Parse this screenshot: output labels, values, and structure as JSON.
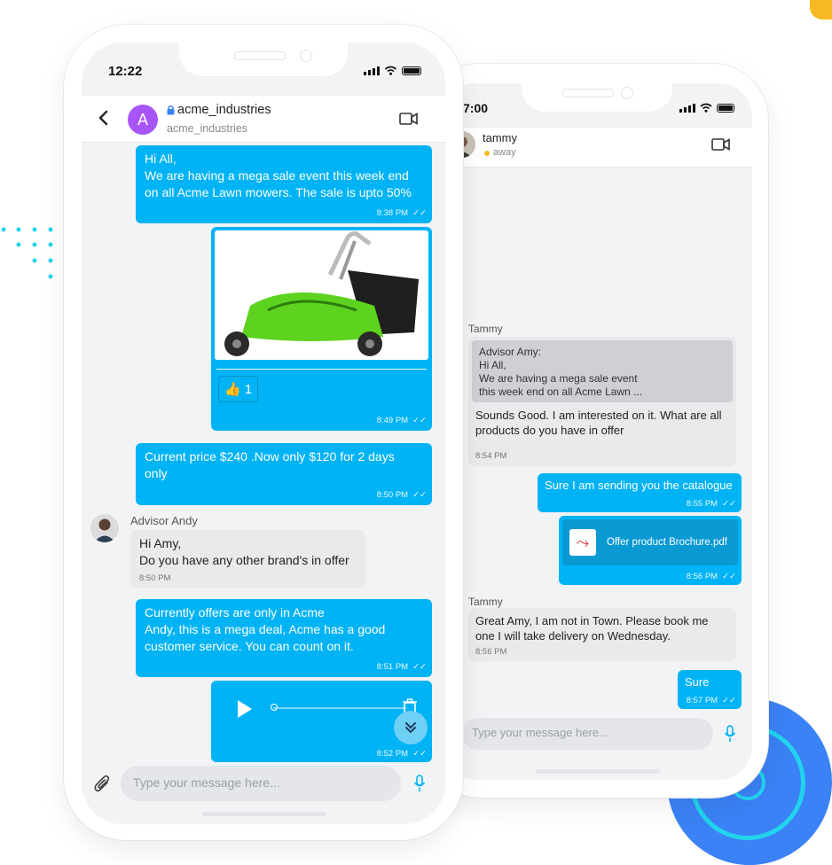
{
  "colors": {
    "accent": "#00b3f5",
    "purple": "#a855f7",
    "yellow": "#f7b924",
    "blue": "#3b82f6",
    "cyan": "#22d3ee",
    "lock": "#3b82f6"
  },
  "left_phone": {
    "time": "12:22",
    "header": {
      "avatar_letter": "A",
      "name": "acme_industries",
      "subtitle": "acme_industries",
      "icons": [
        "back-icon",
        "lock-icon",
        "video-icon"
      ]
    },
    "messages": [
      {
        "text": "Hi All,\nWe are having a mega sale event this week end\non all Acme Lawn mowers. The sale is upto 50%",
        "time": "8:38 PM"
      },
      {
        "image": "green lawn mower",
        "reaction": "👍",
        "reaction_count": "1",
        "time": "8:49 PM"
      },
      {
        "text": "Current price $240 .Now only $120 for 2 days\nonly",
        "time": "8:50 PM"
      },
      {
        "sender": "Advisor Andy",
        "text": "Hi Amy,\nDo you have any other brand's in offer",
        "time": "8:50 PM"
      },
      {
        "text": "Currently offers are only in Acme\nAndy, this is a mega deal, Acme has a good\ncustomer service. You can count on it.",
        "time": "8:51 PM"
      },
      {
        "audio": true,
        "time": "8:52 PM"
      }
    ],
    "input_placeholder": "Type your message here..."
  },
  "right_phone": {
    "time": "7:00",
    "header": {
      "name": "tammy",
      "status": "away"
    },
    "messages": [
      {
        "sender": "Tammy",
        "quote_title": "Advisor Amy:",
        "quote_text": "Hi All,\nWe are having a mega sale event\nthis week end on all Acme Lawn ...",
        "text": "Sounds Good. I am interested on it. What are all\nproducts do you have in offer",
        "time": "8:54 PM"
      },
      {
        "text": "Sure I am sending you the catalogue",
        "time": "8:55 PM"
      },
      {
        "file_name": "Offer product Brochure.pdf",
        "time": "8:56 PM"
      },
      {
        "sender": "Tammy",
        "text": "Great Amy, I am not in Town. Please book me\none I will take delivery on Wednesday.",
        "time": "8:56 PM"
      },
      {
        "text": "Sure",
        "time": "8:57 PM"
      }
    ],
    "input_placeholder": "Type your message here..."
  }
}
